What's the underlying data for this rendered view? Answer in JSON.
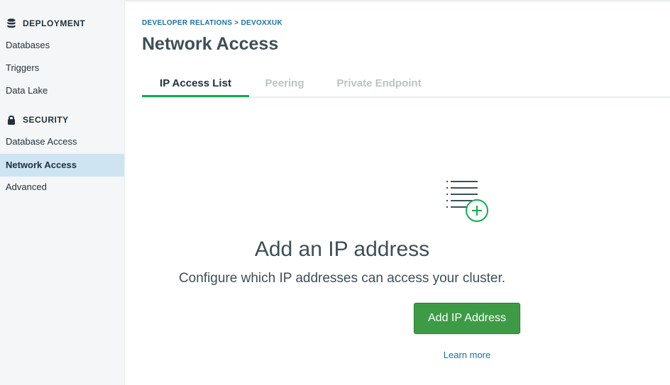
{
  "colors": {
    "accent_green": "#13aa52",
    "button_green": "#3d9b45",
    "link_blue": "#1a6fa8",
    "active_nav_bg": "#cfe4f3"
  },
  "sidebar": {
    "deployment": {
      "heading": "DEPLOYMENT",
      "icon": "database-icon",
      "items": [
        {
          "label": "Databases"
        },
        {
          "label": "Triggers"
        },
        {
          "label": "Data Lake"
        }
      ]
    },
    "security": {
      "heading": "SECURITY",
      "icon": "lock-icon",
      "items": [
        {
          "label": "Database Access"
        },
        {
          "label": "Network Access",
          "active": true
        },
        {
          "label": "Advanced"
        }
      ]
    }
  },
  "header": {
    "breadcrumb": "DEVELOPER RELATIONS > DEVOXXUK",
    "title": "Network Access"
  },
  "tabs": [
    {
      "label": "IP Access List",
      "active": true
    },
    {
      "label": "Peering",
      "active": false
    },
    {
      "label": "Private Endpoint",
      "active": false
    }
  ],
  "empty_state": {
    "icon": "list-add-icon",
    "title": "Add an IP address",
    "description": "Configure which IP addresses can access your cluster.",
    "button_label": "Add IP Address",
    "link_label": "Learn more"
  }
}
